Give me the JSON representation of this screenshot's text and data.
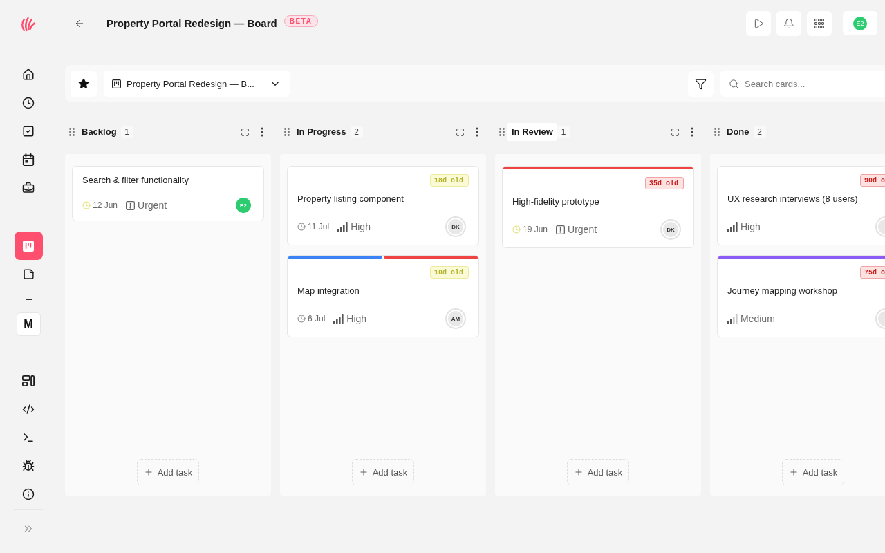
{
  "sidebar": {
    "nav_main": [
      {
        "selected": false
      },
      {
        "selected": false
      },
      {
        "selected": false
      },
      {
        "selected": false
      },
      {
        "selected": false
      }
    ],
    "nav_boards": [
      {
        "selected": true
      },
      {
        "selected": false
      }
    ],
    "workspace": {
      "initial": "M"
    },
    "nav_tools": [
      {
        "selected": false
      },
      {
        "selected": false
      },
      {
        "selected": false
      },
      {
        "selected": false
      },
      {
        "selected": false
      }
    ]
  },
  "header": {
    "title": "Property Portal Redesign — Board",
    "badge": "BETA",
    "user": {
      "initials": "E2",
      "color": "#2ecc71"
    }
  },
  "toolbar": {
    "starred": true,
    "board_select": {
      "value": "Property Portal Redesign — B..."
    },
    "search": {
      "placeholder": "Search cards..."
    }
  },
  "columns": [
    {
      "title": "Backlog",
      "count": "1",
      "title_highlighted": false,
      "cards": [
        {
          "title": "Search & filter functionality",
          "due": {
            "date": "12 Jun",
            "soon": true
          },
          "priority": {
            "kind": "urgent",
            "label": "Urgent"
          },
          "assignee": {
            "kind": "self",
            "initials": "E2",
            "color": "#2ecc71"
          }
        }
      ],
      "add_label": "Add task"
    },
    {
      "title": "In Progress",
      "count": "2",
      "title_highlighted": false,
      "cards": [
        {
          "age": {
            "text": "18d old",
            "stale": false
          },
          "title": "Property listing component",
          "due": {
            "date": "11 Jul",
            "soon": false
          },
          "priority": {
            "kind": "high",
            "label": "High"
          },
          "assignee": {
            "kind": "member",
            "initials": "DK",
            "color": "#e8e8e8"
          }
        },
        {
          "labels": [
            {
              "color": "#3b82f6"
            },
            {
              "color": "#ef4444"
            }
          ],
          "age": {
            "text": "10d old",
            "stale": false
          },
          "title": "Map integration",
          "due": {
            "date": "6 Jul",
            "soon": false
          },
          "priority": {
            "kind": "high",
            "label": "High"
          },
          "assignee": {
            "kind": "member",
            "initials": "AM",
            "color": "#e8e8e8"
          }
        }
      ],
      "add_label": "Add task"
    },
    {
      "title": "In Review",
      "count": "1",
      "title_highlighted": true,
      "cards": [
        {
          "labels": [
            {
              "color": "#ef4444"
            }
          ],
          "age": {
            "text": "35d old",
            "stale": true
          },
          "title": "High-fidelity prototype",
          "due": {
            "date": "19 Jun",
            "soon": true
          },
          "priority": {
            "kind": "urgent",
            "label": "Urgent"
          },
          "assignee": {
            "kind": "member",
            "initials": "DK",
            "color": "#e8e8e8"
          }
        }
      ],
      "add_label": "Add task"
    },
    {
      "title": "Done",
      "count": "2",
      "title_highlighted": false,
      "cards": [
        {
          "age": {
            "text": "90d o",
            "stale": true
          },
          "title": "UX research interviews (8 users)",
          "priority": {
            "kind": "high",
            "label": "High"
          },
          "assignee": {
            "kind": "member",
            "color": "#e8e8e8"
          }
        },
        {
          "labels": [
            {
              "color": "#8b5cf6"
            }
          ],
          "age": {
            "text": "75d o",
            "stale": true
          },
          "title": "Journey mapping workshop",
          "priority": {
            "kind": "medium",
            "label": "Medium"
          },
          "assignee": {
            "kind": "member",
            "color": "#e8e8e8"
          }
        }
      ],
      "add_label": "Add task"
    }
  ]
}
